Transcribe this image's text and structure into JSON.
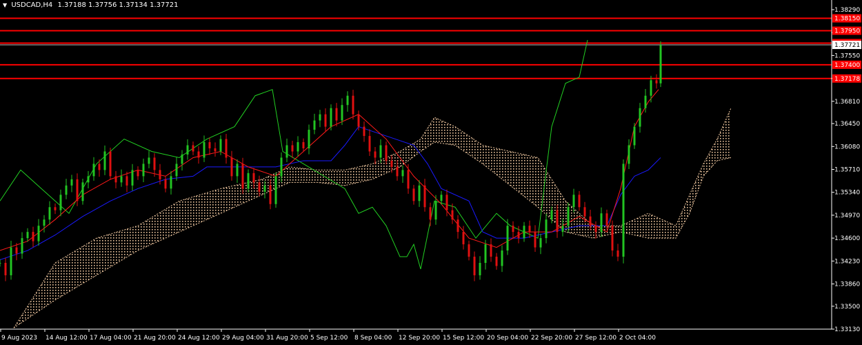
{
  "header": {
    "symbol": "USDCAD,H4",
    "ohlc": "1.37188 1.37756 1.37134 1.37721"
  },
  "colors": {
    "background": "#000000",
    "bull": "#22c422",
    "bear": "#e01010",
    "tenkan": "#ff1a1a",
    "kijun": "#1a1aff",
    "chikou": "#22d022",
    "cloud": "#f0c8a0",
    "level": "#ff0000",
    "axis": "#ffffff"
  },
  "chart_data": {
    "type": "line",
    "title": "USDCAD,H4",
    "ylim": [
      1.3313,
      1.3829
    ],
    "y_ticks": [
      "1.38290",
      "1.37920",
      "1.37550",
      "1.37180",
      "1.36810",
      "1.36450",
      "1.36080",
      "1.35710",
      "1.35340",
      "1.34970",
      "1.34600",
      "1.34230",
      "1.33860",
      "1.33500",
      "1.33130"
    ],
    "x_ticks": [
      "9 Aug 2023",
      "14 Aug 12:00",
      "17 Aug 04:00",
      "21 Aug 20:00",
      "24 Aug 12:00",
      "29 Aug 04:00",
      "31 Aug 20:00",
      "5 Sep 12:00",
      "8 Sep 04:00",
      "12 Sep 20:00",
      "15 Sep 12:00",
      "20 Sep 04:00",
      "22 Sep 20:00",
      "27 Sep 12:00",
      "2 Oct 04:00"
    ],
    "current_price": "1.37721",
    "levels": [
      "1.38150",
      "1.37950",
      "1.37750",
      "1.37400",
      "1.37178"
    ],
    "series": [
      {
        "name": "close",
        "x": [
          0,
          8,
          16,
          24,
          32,
          40,
          48,
          56,
          64,
          72,
          80,
          88,
          96,
          104,
          112,
          120,
          128,
          136,
          144,
          152,
          160,
          168,
          176,
          184,
          192,
          200,
          208,
          216,
          224,
          232,
          240,
          248,
          256,
          264,
          272,
          280,
          288,
          296,
          304,
          312,
          320,
          328,
          336,
          344,
          352,
          360,
          368,
          376,
          384,
          392,
          400,
          408,
          416,
          424,
          432,
          440,
          448,
          456,
          464,
          472,
          480,
          488,
          496,
          504,
          512,
          520,
          528,
          536,
          544,
          552,
          560,
          568,
          576,
          584,
          592,
          600,
          608,
          616,
          624,
          632,
          640,
          648,
          656,
          664,
          672,
          680,
          688,
          696,
          704,
          712,
          720,
          728,
          736,
          744,
          752,
          760,
          768,
          776,
          784,
          792,
          800,
          808,
          816,
          824,
          832,
          840,
          848,
          856,
          864,
          872,
          880,
          888,
          896,
          904,
          912,
          920,
          928,
          936,
          944,
          952,
          958
        ],
        "values": [
          1.342,
          1.34,
          1.3445,
          1.3435,
          1.346,
          1.347,
          1.3455,
          1.348,
          1.349,
          1.351,
          1.3505,
          1.353,
          1.3545,
          1.3555,
          1.352,
          1.355,
          1.356,
          1.358,
          1.357,
          1.36,
          1.356,
          1.355,
          1.356,
          1.3545,
          1.357,
          1.356,
          1.358,
          1.359,
          1.357,
          1.3555,
          1.354,
          1.356,
          1.358,
          1.3595,
          1.361,
          1.36,
          1.359,
          1.3615,
          1.3605,
          1.36,
          1.362,
          1.359,
          1.356,
          1.358,
          1.354,
          1.3565,
          1.355,
          1.3535,
          1.3545,
          1.3515,
          1.356,
          1.359,
          1.361,
          1.36,
          1.3615,
          1.3605,
          1.3635,
          1.365,
          1.366,
          1.364,
          1.367,
          1.365,
          1.3675,
          1.369,
          1.366,
          1.364,
          1.3625,
          1.36,
          1.359,
          1.361,
          1.3585,
          1.3575,
          1.356,
          1.357,
          1.354,
          1.352,
          1.3545,
          1.351,
          1.349,
          1.352,
          1.353,
          1.3505,
          1.349,
          1.347,
          1.345,
          1.343,
          1.34,
          1.342,
          1.345,
          1.343,
          1.3415,
          1.344,
          1.348,
          1.347,
          1.346,
          1.348,
          1.347,
          1.3445,
          1.346,
          1.349,
          1.3505,
          1.347,
          1.348,
          1.351,
          1.353,
          1.351,
          1.3495,
          1.348,
          1.347,
          1.35,
          1.348,
          1.344,
          1.343,
          1.358,
          1.361,
          1.364,
          1.367,
          1.369,
          1.3715,
          1.371,
          1.3772
        ]
      },
      {
        "name": "tenkan",
        "x": [
          0,
          40,
          80,
          120,
          160,
          200,
          240,
          280,
          320,
          360,
          400,
          440,
          480,
          520,
          560,
          600,
          640,
          680,
          720,
          760,
          800,
          840,
          880,
          900,
          920,
          940,
          955
        ],
        "values": [
          1.344,
          1.3455,
          1.349,
          1.353,
          1.3555,
          1.357,
          1.356,
          1.359,
          1.36,
          1.3575,
          1.356,
          1.36,
          1.364,
          1.366,
          1.362,
          1.356,
          1.3515,
          1.346,
          1.3445,
          1.347,
          1.347,
          1.3495,
          1.347,
          1.354,
          1.364,
          1.368,
          1.37
        ]
      },
      {
        "name": "kijun",
        "x": [
          0,
          40,
          80,
          120,
          160,
          200,
          240,
          280,
          300,
          360,
          400,
          440,
          480,
          500,
          520,
          560,
          600,
          620,
          640,
          680,
          700,
          720,
          760,
          800,
          840,
          880,
          900,
          920,
          940,
          958
        ],
        "values": [
          1.3425,
          1.344,
          1.3465,
          1.3495,
          1.352,
          1.354,
          1.3555,
          1.356,
          1.3575,
          1.3575,
          1.3575,
          1.3585,
          1.3585,
          1.361,
          1.364,
          1.3625,
          1.361,
          1.358,
          1.354,
          1.352,
          1.347,
          1.346,
          1.346,
          1.347,
          1.348,
          1.348,
          1.353,
          1.356,
          1.357,
          1.359
        ]
      },
      {
        "name": "chikou",
        "x": [
          0,
          30,
          60,
          100,
          140,
          180,
          220,
          260,
          300,
          340,
          370,
          395,
          410,
          440,
          470,
          500,
          520,
          540,
          560,
          580,
          590,
          600,
          610,
          630,
          660,
          690,
          720,
          740,
          760,
          780,
          800,
          820,
          840,
          852
        ],
        "values": [
          1.352,
          1.357,
          1.354,
          1.35,
          1.358,
          1.362,
          1.36,
          1.359,
          1.362,
          1.364,
          1.369,
          1.37,
          1.36,
          1.358,
          1.356,
          1.354,
          1.35,
          1.351,
          1.348,
          1.343,
          1.343,
          1.345,
          1.341,
          1.352,
          1.351,
          1.346,
          1.35,
          1.348,
          1.347,
          1.346,
          1.364,
          1.371,
          1.372,
          1.378
        ]
      },
      {
        "name": "senkou_a",
        "x": [
          20,
          80,
          140,
          200,
          260,
          320,
          380,
          420,
          460,
          500,
          540,
          580,
          610,
          630,
          660,
          700,
          740,
          780,
          820,
          860,
          900,
          940,
          980,
          1000,
          1020,
          1040,
          1060
        ],
        "values": [
          1.3315,
          1.342,
          1.346,
          1.348,
          1.352,
          1.354,
          1.3555,
          1.3575,
          1.357,
          1.357,
          1.358,
          1.36,
          1.362,
          1.3655,
          1.364,
          1.361,
          1.36,
          1.359,
          1.352,
          1.348,
          1.348,
          1.35,
          1.348,
          1.353,
          1.358,
          1.362,
          1.367
        ]
      },
      {
        "name": "senkou_b",
        "x": [
          20,
          80,
          140,
          200,
          260,
          320,
          380,
          420,
          460,
          500,
          540,
          580,
          610,
          630,
          660,
          700,
          740,
          780,
          820,
          860,
          900,
          940,
          980,
          1000,
          1020,
          1040,
          1060
        ],
        "values": [
          1.3315,
          1.336,
          1.34,
          1.344,
          1.347,
          1.35,
          1.353,
          1.355,
          1.355,
          1.3545,
          1.3555,
          1.3575,
          1.36,
          1.3615,
          1.361,
          1.358,
          1.3545,
          1.351,
          1.347,
          1.346,
          1.347,
          1.346,
          1.346,
          1.35,
          1.356,
          1.3585,
          1.359
        ]
      }
    ]
  }
}
